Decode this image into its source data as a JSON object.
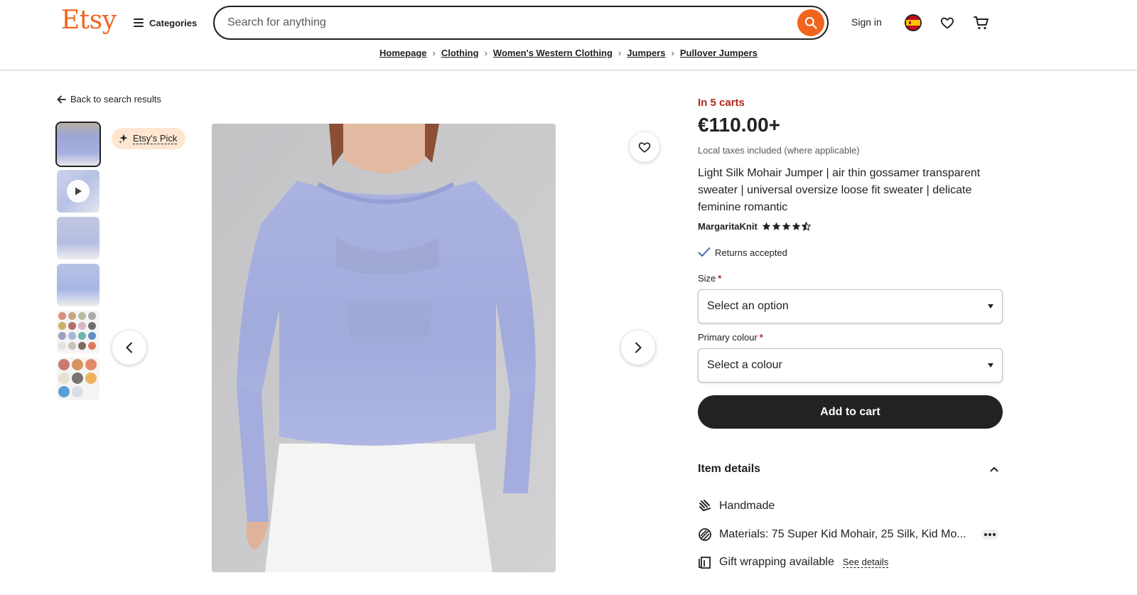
{
  "header": {
    "logo": "Etsy",
    "categories_label": "Categories",
    "search_placeholder": "Search for anything",
    "sign_in": "Sign in"
  },
  "breadcrumb": [
    "Homepage",
    "Clothing",
    "Women's Western Clothing",
    "Jumpers",
    "Pullover Jumpers"
  ],
  "gallery": {
    "back_label": "Back to search results",
    "badge": "Etsy's Pick"
  },
  "product": {
    "in_carts": "In 5 carts",
    "price": "€110.00+",
    "tax_note": "Local taxes included (where applicable)",
    "title": "Light Silk Mohair Jumper | air thin gossamer transparent sweater | universal oversize loose fit sweater | delicate feminine romantic",
    "seller": "MargaritaKnit",
    "rating": 4.5,
    "returns": "Returns accepted",
    "size_label": "Size",
    "size_value": "Select an option",
    "colour_label": "Primary colour",
    "colour_value": "Select a colour",
    "add_to_cart": "Add to cart",
    "required_mark": "*"
  },
  "details": {
    "heading": "Item details",
    "handmade": "Handmade",
    "materials": "Materials: 75 Super Kid Mohair, 25 Silk, Kid Mo...",
    "gift": "Gift wrapping available",
    "see_details": "See details"
  },
  "colors": {
    "brand": "#f1641e",
    "alert": "#b3261e",
    "badge_bg": "#fde7d1"
  }
}
